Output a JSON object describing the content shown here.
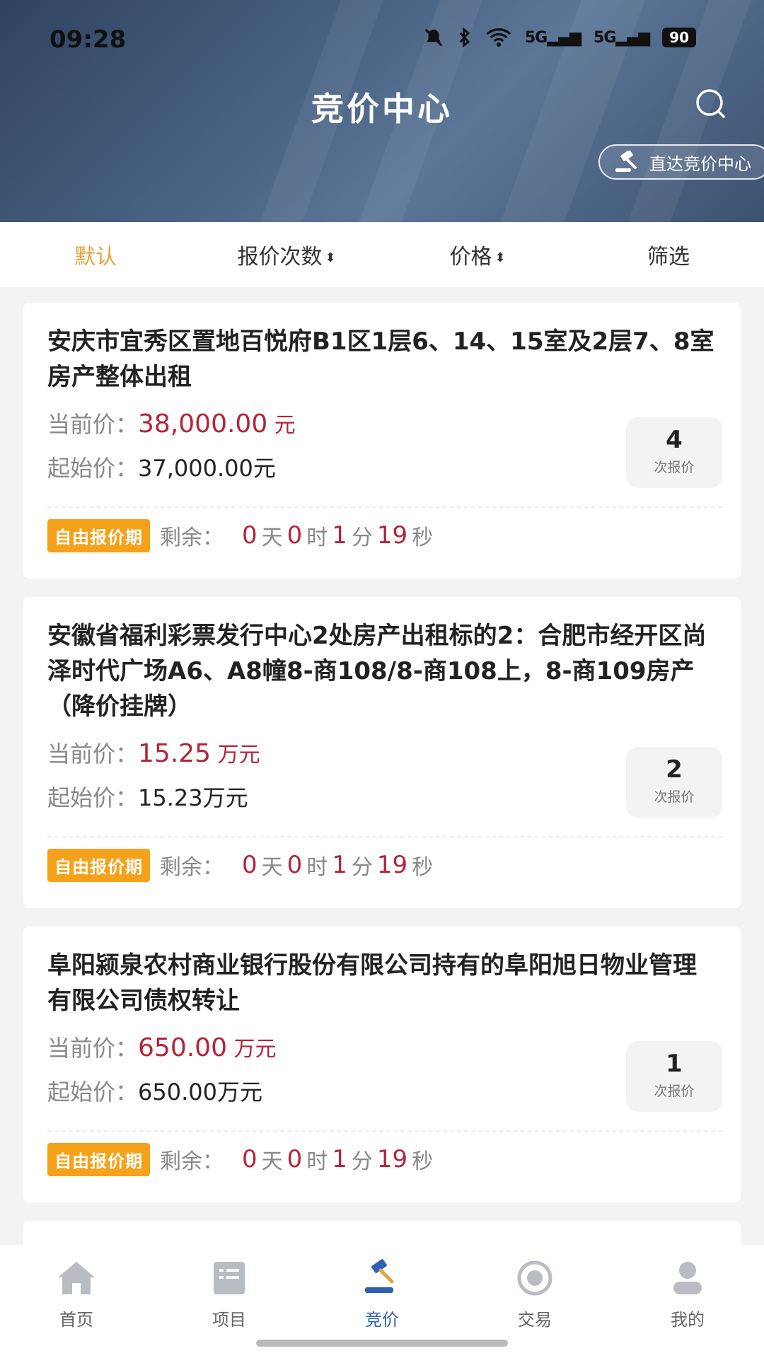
{
  "status": {
    "time": "09:28",
    "battery": "90",
    "net1": "5G",
    "net2": "5G"
  },
  "header": {
    "title": "竞价中心",
    "direct_label": "直达竞价中心"
  },
  "sort": {
    "default": "默认",
    "bid_count": "报价次数",
    "price": "价格",
    "filter": "筛选",
    "arrow": "⬍"
  },
  "labels": {
    "current": "当前价：",
    "start": "起始价：",
    "bid_unit": "次报价",
    "tag": "自由报价期",
    "remain": "剩余：",
    "day": "天",
    "hour": "时",
    "min": "分",
    "sec": "秒"
  },
  "cards": [
    {
      "title": "安庆市宜秀区置地百悦府B1区1层6、14、15室及2层7、8室房产整体出租",
      "current_price": "38,000.00",
      "current_unit": " 元",
      "start_price": "37,000.00元",
      "bids": "4",
      "d": "0",
      "h": "0",
      "m": "1",
      "s": "19"
    },
    {
      "title": "安徽省福利彩票发行中心2处房产出租标的2：合肥市经开区尚泽时代广场A6、A8幢8-商108/8-商108上，8-商109房产（降价挂牌）",
      "current_price": "15.25",
      "current_unit": " 万元",
      "start_price": "15.23万元",
      "bids": "2",
      "d": "0",
      "h": "0",
      "m": "1",
      "s": "19"
    },
    {
      "title": "阜阳颍泉农村商业银行股份有限公司持有的阜阳旭日物业管理有限公司债权转让",
      "current_price": "650.00",
      "current_unit": " 万元",
      "start_price": "650.00万元",
      "bids": "1",
      "d": "0",
      "h": "0",
      "m": "1",
      "s": "19"
    }
  ],
  "nav": {
    "home": "首页",
    "projects": "项目",
    "bidding": "竞价",
    "trade": "交易",
    "mine": "我的"
  },
  "colors": {
    "accent": "#e5a43a",
    "price": "#b3253a",
    "tag": "#f6a11a",
    "nav_active": "#2f5fb3"
  }
}
